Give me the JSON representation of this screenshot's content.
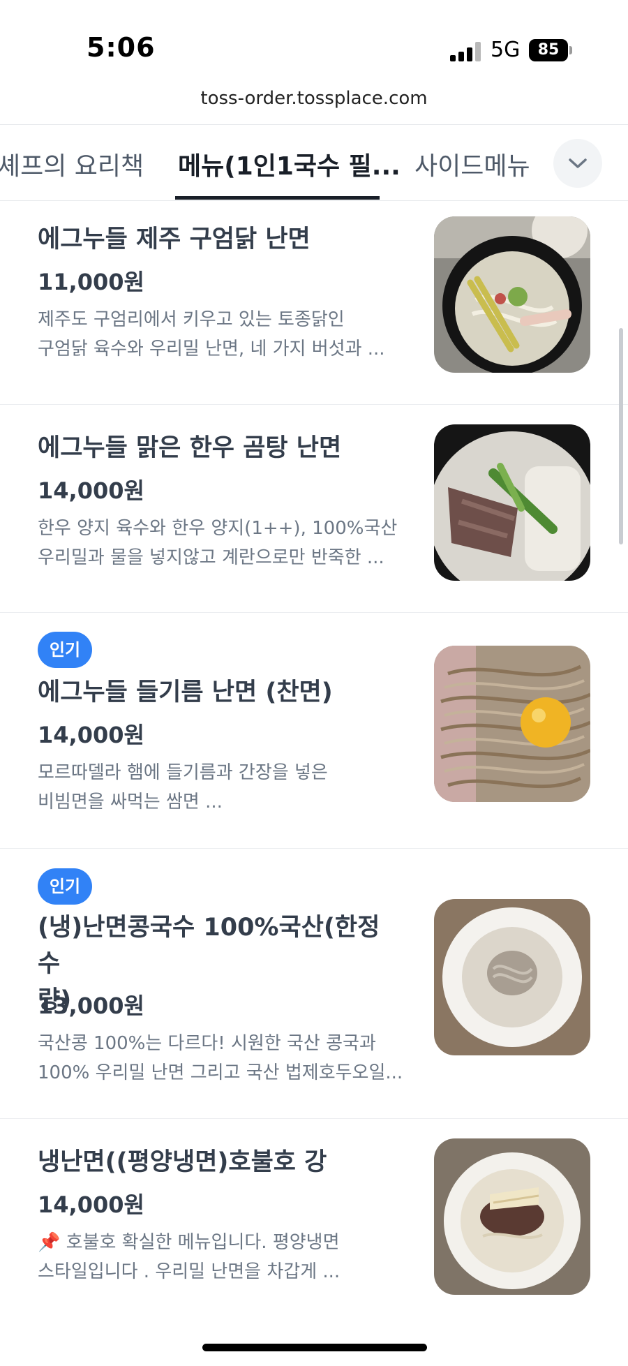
{
  "status": {
    "time": "5:06",
    "network": "5G",
    "battery": "85"
  },
  "browser": {
    "url": "toss-order.tossplace.com"
  },
  "tabs": [
    {
      "label": "셰프의 요리책"
    },
    {
      "label": "메뉴(1인1국수 필..."
    },
    {
      "label": "사이드메뉴"
    }
  ],
  "icons": {
    "tab_more": "chevron-down-icon"
  },
  "colors": {
    "badge": "#3182f6",
    "text_primary": "#333d4b",
    "text_secondary": "#6b7684"
  },
  "menu": [
    {
      "badge": "",
      "name_lines": [
        "에그누들 제주 구엄닭 난면"
      ],
      "price": "11,000원",
      "desc_lines": [
        "제주도 구엄리에서 키우고 있는 토종닭인",
        "구엄닭 육수와 우리밀 난면, 네 가지 버섯과 ..."
      ],
      "image": "chicken-noodle-soup"
    },
    {
      "badge": "",
      "name_lines": [
        "에그누들 맑은 한우 곰탕 난면"
      ],
      "price": "14,000원",
      "desc_lines": [
        "한우 양지 육수와 한우 양지(1++), 100%국산",
        "우리밀과 물을 넣지않고 계란으로만 반죽한 ..."
      ],
      "image": "beef-noodle-soup"
    },
    {
      "badge": "인기",
      "name_lines": [
        "에그누들 들기름 난면 (찬면)"
      ],
      "price": "14,000원",
      "desc_lines": [
        "모르따델라 햄에 들기름과 간장을 넣은",
        "비빔면을 싸먹는 쌈면 ..."
      ],
      "image": "perilla-oil-noodles"
    },
    {
      "badge": "인기",
      "name_lines": [
        "(냉)난면콩국수 100%국산(한정수",
        "량)"
      ],
      "price": "13,000원",
      "desc_lines": [
        "국산콩 100%는 다르다! 시원한 국산 콩국과",
        "100% 우리밀 난면 그리고 국산 법제호두오일..."
      ],
      "image": "soy-milk-noodles"
    },
    {
      "badge": "",
      "name_lines": [
        "냉난면((평양냉면)호불호 강"
      ],
      "price": "14,000원",
      "desc_lines": [
        "📌 호불호 확실한 메뉴입니다. 평양냉면",
        "스타일입니다 . 우리밀 난면을 차갑게 ..."
      ],
      "image": "cold-noodles"
    }
  ]
}
